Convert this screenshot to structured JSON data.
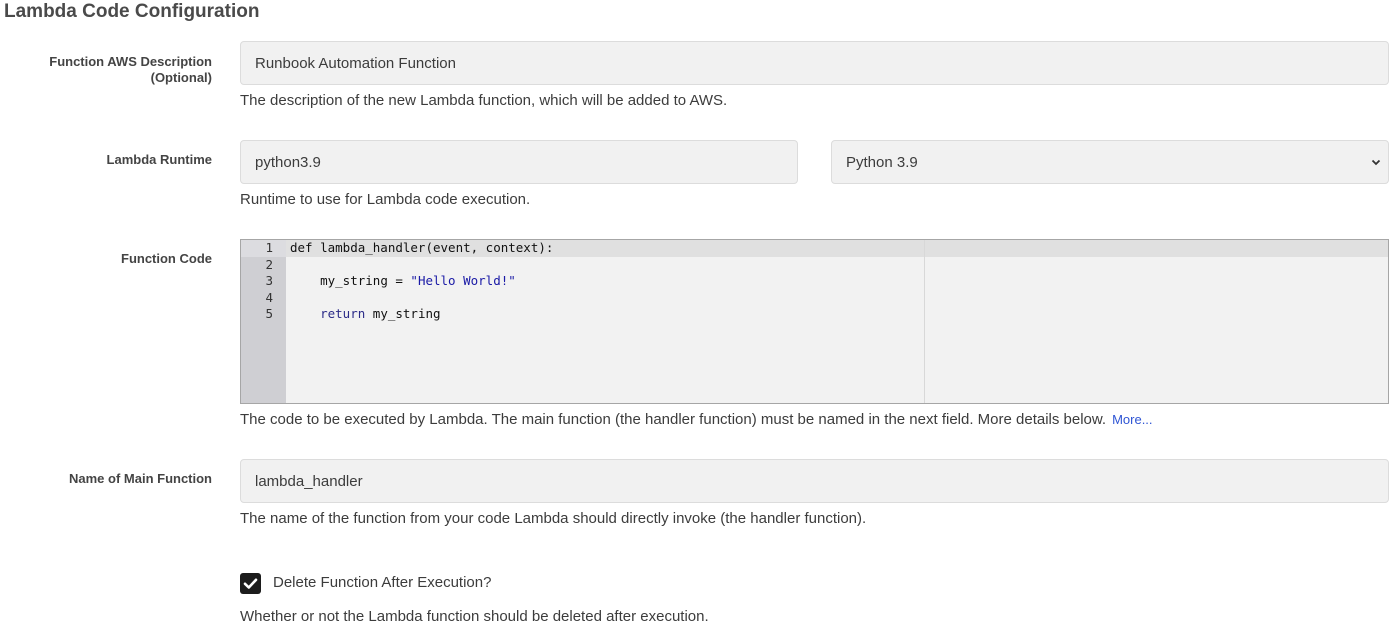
{
  "section": {
    "title": "Lambda Code Configuration"
  },
  "description": {
    "label_line1": "Function AWS Description",
    "label_line2": "(Optional)",
    "value": "Runbook Automation Function",
    "help": "The description of the new Lambda function, which will be added to AWS."
  },
  "runtime": {
    "label": "Lambda Runtime",
    "value": "python3.9",
    "select_value": "Python 3.9",
    "help": "Runtime to use for Lambda code execution."
  },
  "code": {
    "label": "Function Code",
    "line_numbers": [
      "1",
      "2",
      "3",
      "4",
      "5"
    ],
    "lines": [
      {
        "plain": "def lambda_handler(event, context):"
      },
      {
        "plain": ""
      },
      {
        "indent": "    ",
        "var": "my_string",
        "op": " = ",
        "str": "\"Hello World!\""
      },
      {
        "plain": ""
      },
      {
        "indent": "    ",
        "kw": "return",
        "rest": " my_string"
      }
    ],
    "help": "The code to be executed by Lambda. The main function (the handler function) must be named in the next field. More details below.",
    "more_link": "More..."
  },
  "main_function": {
    "label": "Name of Main Function",
    "value": "lambda_handler",
    "help": "The name of the function from your code Lambda should directly invoke (the handler function)."
  },
  "delete_after": {
    "label": "Delete Function After Execution?",
    "checked": true,
    "help": "Whether or not the Lambda function should be deleted after execution."
  }
}
